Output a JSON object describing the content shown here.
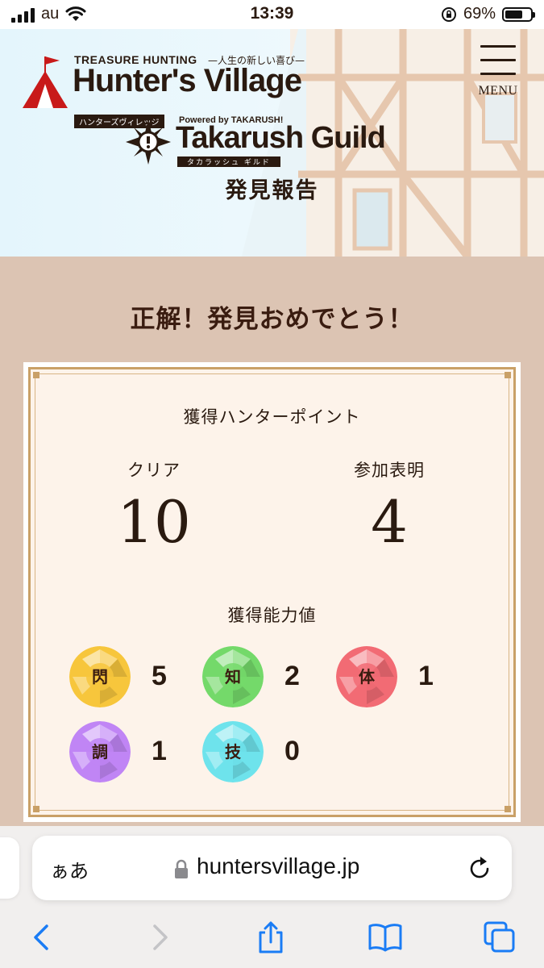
{
  "status_bar": {
    "carrier": "au",
    "time": "13:39",
    "battery_text": "69%",
    "battery_level": 0.69
  },
  "header": {
    "logo": {
      "tagline": "TREASURE HUNTING",
      "sub_jp": "—人生の新しい喜び—",
      "name": "Hunter's Village",
      "kana": "ハンターズヴィレッジ",
      "powered_by": "Powered by TAKARUSH!"
    },
    "menu_label": "MENU",
    "guild": {
      "name": "Takarush Guild",
      "kana": "タカラッシュ ギルド"
    },
    "page_title": "発見報告"
  },
  "main": {
    "congrats": "正解！発見おめでとう！",
    "points": {
      "title": "獲得ハンターポイント",
      "items": [
        {
          "label": "クリア",
          "value": "10"
        },
        {
          "label": "参加表明",
          "value": "4"
        }
      ]
    },
    "abilities": {
      "title": "獲得能力値",
      "items": [
        {
          "char": "閃",
          "value": "5",
          "color": "#f7c63c"
        },
        {
          "char": "知",
          "value": "2",
          "color": "#74d96a"
        },
        {
          "char": "体",
          "value": "1",
          "color": "#f26b74"
        },
        {
          "char": "調",
          "value": "1",
          "color": "#c085f5"
        },
        {
          "char": "技",
          "value": "0",
          "color": "#6ee3ec"
        }
      ]
    }
  },
  "browser": {
    "aa_label": "ぁあ",
    "url": "huntersvillage.jp",
    "icons": [
      "back-icon",
      "forward-icon",
      "share-icon",
      "bookmarks-icon",
      "tabs-icon"
    ]
  },
  "colors": {
    "accent_brown": "#2a1a10",
    "panel_bg": "#dcc4b3",
    "card_bg": "#fdf3ea",
    "card_border": "#c9a067",
    "link_blue": "#1a7cf5"
  }
}
